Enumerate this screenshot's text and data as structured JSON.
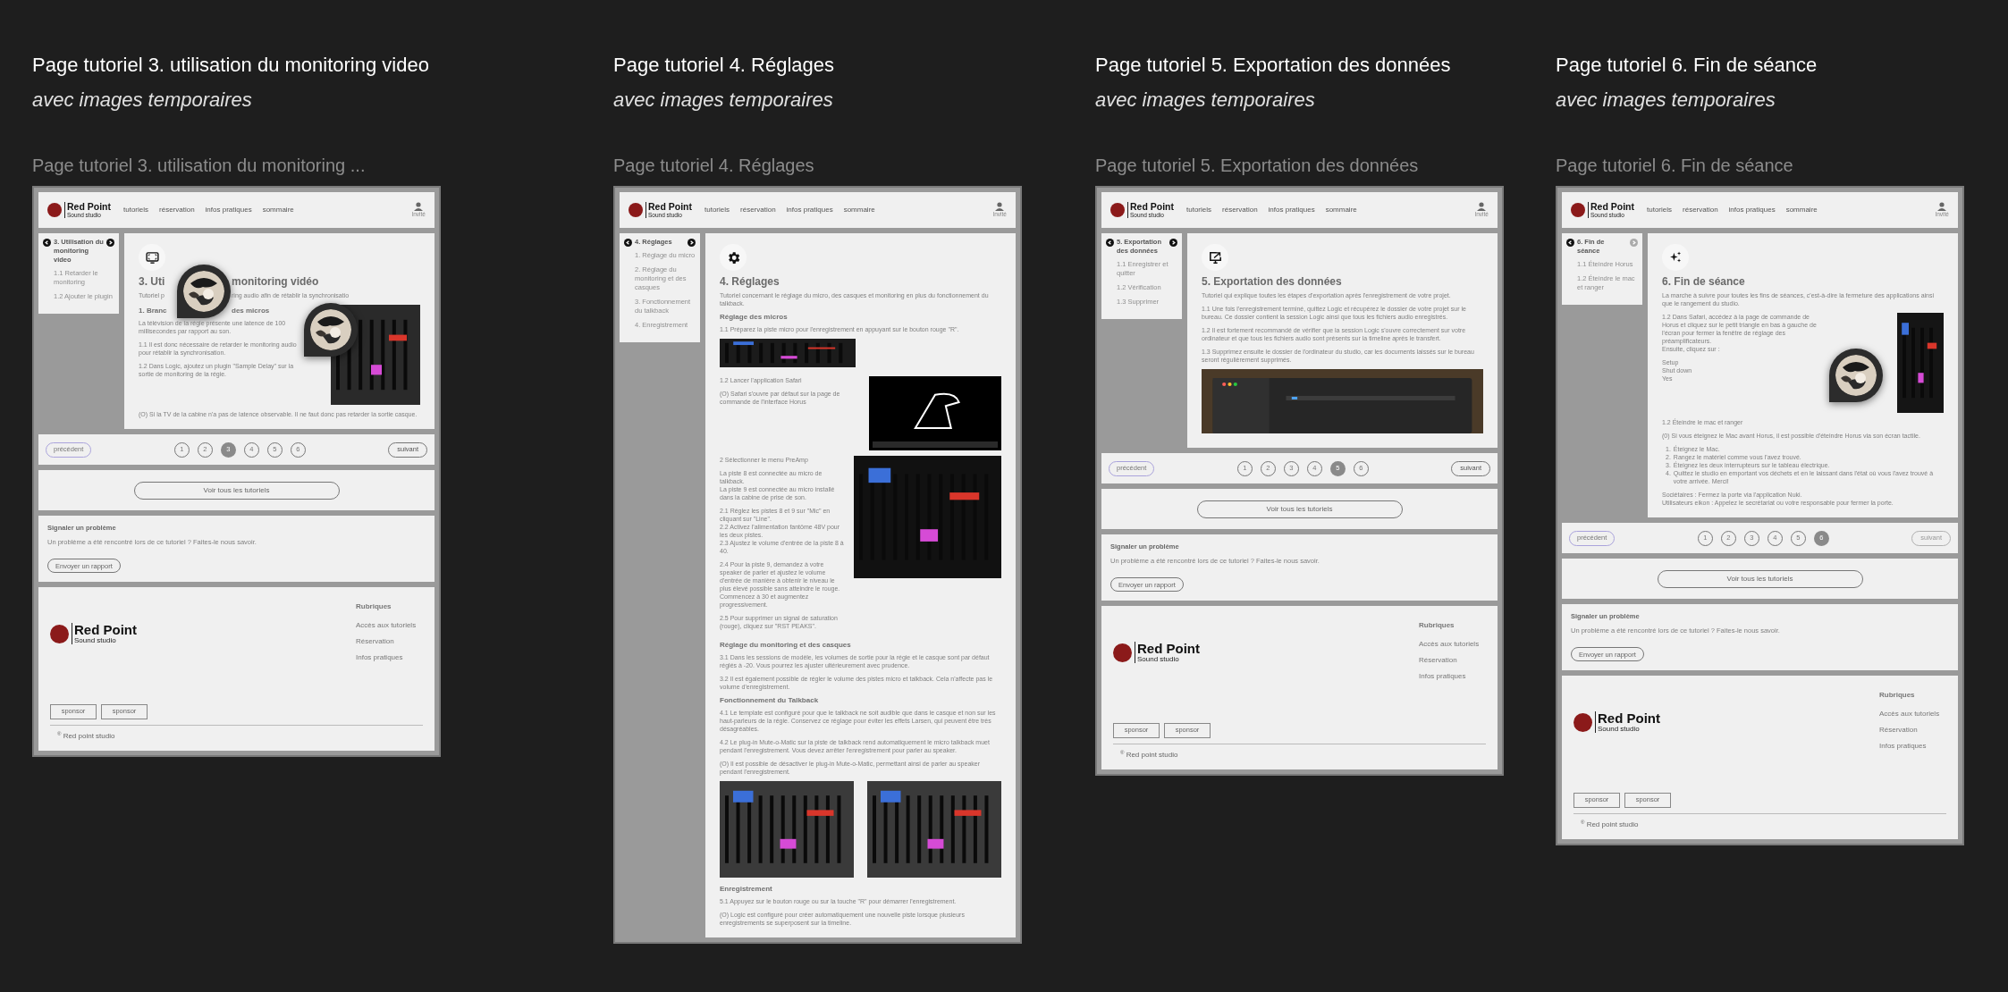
{
  "sections": [
    {
      "heading": "Page tutoriel 3. utilisation du monitoring video",
      "subheading": "avec images temporaires",
      "frame_label": "Page tutoriel 3. utilisation du monitoring ...",
      "frame": {
        "nav": {
          "brand": "Red Point",
          "brand_sub": "Sound studio",
          "links": [
            "tutoriels",
            "réservation",
            "infos pratiques",
            "sommaire"
          ],
          "user": "Invité"
        },
        "sidebar": {
          "title": "3. Utilisation du monitoring video",
          "prev_disabled": false,
          "next_disabled": false,
          "items": [
            "1.1 Retarder le monitoring",
            "1.2 Ajouter le plugin"
          ]
        },
        "article": {
          "blocks": [
            {
              "kind": "title",
              "parts": [
                "3. Uti",
                "monitoring vidéo"
              ],
              "comment_pin": true
            },
            {
              "kind": "lead",
              "parts": [
                "Tutoriel p",
                "ring audio afin de rétablir la synchronisatio"
              ]
            },
            {
              "kind": "split",
              "left": [
                {
                  "kind": "heading",
                  "parts": [
                    "1. Branc",
                    "des micros"
                  ]
                },
                {
                  "kind": "para",
                  "text": "La télévision de la régie présente une latence de 100 millisecondes par rapport au son."
                },
                {
                  "kind": "para",
                  "text": "1.1 Il est donc nécessaire de retarder le monitoring audio pour rétablir la synchronisation."
                },
                {
                  "kind": "para",
                  "text": "1.2 Dans Logic, ajoutez un plugin \"Sample Delay\" sur la sortie de monitoring de la régie."
                }
              ],
              "image": {
                "kind": "picture",
                "comment_pin": true
              }
            },
            {
              "kind": "para",
              "text": "(O) Si la TV de la cabine n'a pas de latence observable. Il ne faut donc pas retarder la sortie casque."
            }
          ]
        },
        "pager": {
          "prev": "précédent",
          "next": "suivant",
          "next_disabled": false,
          "pages": [
            {
              "label": "1",
              "selected": false
            },
            {
              "label": "2",
              "selected": false
            },
            {
              "label": "3",
              "selected": true
            },
            {
              "label": "4",
              "selected": false
            },
            {
              "label": "5",
              "selected": false
            },
            {
              "label": "6",
              "selected": false
            }
          ]
        },
        "all_button": "Voir tous les tutoriels",
        "report": {
          "title": "Signaler un problème",
          "text": "Un problème a été rencontré lors de ce tutoriel ? Faites-le nous savoir.",
          "button": "Envoyer un rapport"
        },
        "footer": {
          "brand": "Red Point",
          "brand_sub": "Sound studio",
          "heading": "Rubriques",
          "links": [
            "Accès aux tutoriels",
            "Réservation",
            "Infos pratiques"
          ],
          "sponsors": [
            "sponsor",
            "sponsor"
          ],
          "copyright": "$^{®}$ Red point studio"
        }
      }
    },
    {
      "heading": "Page tutoriel 4. Réglages",
      "subheading": "avec images temporaires",
      "frame_label": "Page tutoriel 4. Réglages",
      "frame": {
        "nav": {
          "brand": "Red Point",
          "brand_sub": "Sound studio",
          "links": [
            "tutoriels",
            "réservation",
            "infos pratiques",
            "sommaire"
          ],
          "user": "Invité"
        },
        "sidebar": {
          "title": "4. Réglages",
          "prev_disabled": false,
          "next_disabled": false,
          "items": [
            "1. Réglage du micro",
            "2. Réglage du monitoring et des casques",
            "3. Fonctionnement du talkback",
            "4. Enregistrement"
          ]
        },
        "article": {
          "blocks": [
            {
              "kind": "title",
              "text": "4. Réglages"
            },
            {
              "kind": "lead",
              "text": "Tutoriel concernant le réglage du micro, des casques et monitoring en plus du fonctionnement du talkback."
            },
            {
              "kind": "heading",
              "text": "Réglage des micros"
            },
            {
              "kind": "para",
              "text": "1.1 Préparez la piste micro pour l'enregistrement en appuyant sur le bouton rouge \"R\"."
            },
            {
              "image": {
                "kind": "picture"
              }
            },
            {
              "kind": "split",
              "left": [
                {
                  "kind": "para",
                  "text": "1.2 Lancer l'application Safari"
                },
                {
                  "kind": "para",
                  "text": "(O) Safari s'ouvre par défaut sur la page de commande de l'interface Horus"
                }
              ],
              "image": {
                "kind": "picture"
              }
            },
            {
              "kind": "split",
              "left": [
                {
                  "kind": "para",
                  "text": "2 Sélectionner le menu PreAmp"
                },
                {
                  "kind": "para",
                  "text": "La piste 8 est connectée au micro de talkback.\nLa piste 9 est connectée au micro installé dans la cabine de prise de son."
                },
                {
                  "kind": "para",
                  "text": "2.1 Réglez les pistes 8 et 9 sur \"Mic\" en cliquant sur \"Line\".\n2.2  Activez l'alimentation fantôme 48V pour les deux pistes.\n2.3 Ajustez le volume d'entrée de la piste 8 à 40."
                },
                {
                  "kind": "para",
                  "text": "2.4 Pour la piste 9, demandez à votre speaker de parler et ajustez le volume d'entrée de manière à obtenir le niveau le plus élevé possible sans atteindre le rouge. Commencez à 30 et augmentez progressivement."
                },
                {
                  "kind": "para",
                  "text": "2.5 Pour supprimer un signal de saturation (rouge), cliquez sur \"RST PEAKS\"."
                }
              ],
              "image": {
                "kind": "picture"
              }
            },
            {
              "kind": "heading",
              "text": "Réglage du monitoring et des casques"
            },
            {
              "kind": "para",
              "text": "3.1 Dans les sessions de modèle, les volumes de sortie pour la régie et le casque sont par défaut réglés à -20. Vous pourrez les ajuster ultérieurement avec prudence."
            },
            {
              "kind": "para",
              "text": "3.2 Il est également possible de régler le volume des pistes micro et talkback. Cela n'affecte pas le volume d'enregistrement."
            },
            {
              "kind": "heading",
              "text": "Fonctionnement du Talkback"
            },
            {
              "kind": "para",
              "text": "4.1 Le template est configuré pour que le talkback ne soit audible que dans le casque et non sur les haut-parleurs de la régie. Conservez ce réglage pour éviter les effets Larsen, qui peuvent être très désagréables."
            },
            {
              "kind": "para",
              "text": "4.2 Le plug-in Mute-o-Matic sur la piste de talkback rend automatiquement le micro talkback muet pendant l'enregistrement. Vous devez arrêter l'enregistrement pour parler au speaker."
            },
            {
              "kind": "para",
              "text": "(O) Il est possible de désactiver le plug-in Mute-o-Matic, permettant ainsi de parler au speaker pendant l'enregistrement."
            },
            {
              "kind": "pair",
              "images": [
                {
                  "kind": "picture"
                },
                {
                  "kind": "picture"
                }
              ]
            },
            {
              "kind": "heading",
              "text": "Enregistrement"
            },
            {
              "kind": "para",
              "text": "5.1 Appuyez sur le bouton rouge ou sur la touche \"R\" pour démarrer l'enregistrement."
            },
            {
              "kind": "para",
              "text": "(O) Logic est configuré pour créer automatiquement une nouvelle piste lorsque plusieurs enregistrements se superposent sur la timeline."
            }
          ]
        }
      }
    },
    {
      "heading": "Page tutoriel 5. Exportation des données",
      "subheading": "avec images temporaires",
      "frame_label": "Page tutoriel 5. Exportation des données",
      "frame": {
        "nav": {
          "brand": "Red Point",
          "brand_sub": "Sound studio",
          "links": [
            "tutoriels",
            "réservation",
            "infos pratiques",
            "sommaire"
          ],
          "user": "Invité"
        },
        "sidebar": {
          "title": "5. Exportation des données",
          "prev_disabled": false,
          "next_disabled": false,
          "items": [
            "1.1 Enregistrer et quitter",
            "1.2 Vérification",
            "1.3 Supprimer"
          ]
        },
        "article": {
          "blocks": [
            {
              "kind": "title",
              "text": "5. Exportation des données"
            },
            {
              "kind": "lead",
              "text": "Tutoriel qui explique toutes les étapes d'exportation après l'enregistrement de votre projet."
            },
            {
              "kind": "para",
              "text": "1.1 Une fois l'enregistrement terminé, quittez Logic et récupérez le dossier de votre projet sur le bureau. Ce dossier contient la session Logic ainsi que tous les fichiers audio enregistrés."
            },
            {
              "kind": "para",
              "text": "1.2 Il est fortement recommandé de vérifier que la session Logic s'ouvre correctement sur votre ordinateur et que tous les fichiers audio sont présents sur la timeline après le transfert."
            },
            {
              "kind": "para",
              "text": "1.3 Supprimez ensuite le dossier de l'ordinateur du studio, car les documents laissés sur le bureau seront régulièrement supprimés."
            },
            {
              "image": {
                "kind": "picture"
              }
            }
          ]
        },
        "pager": {
          "prev": "précédent",
          "next": "suivant",
          "next_disabled": false,
          "pages": [
            {
              "label": "1",
              "selected": false
            },
            {
              "label": "2",
              "selected": false
            },
            {
              "label": "3",
              "selected": false
            },
            {
              "label": "4",
              "selected": false
            },
            {
              "label": "5",
              "selected": true
            },
            {
              "label": "6",
              "selected": false
            }
          ]
        },
        "all_button": "Voir tous les tutoriels",
        "report": {
          "title": "Signaler un problème",
          "text": "Un problème a été rencontré lors de ce tutoriel ? Faites-le nous savoir.",
          "button": "Envoyer un rapport"
        },
        "footer": {
          "brand": "Red Point",
          "brand_sub": "Sound studio",
          "heading": "Rubriques",
          "links": [
            "Accès aux tutoriels",
            "Réservation",
            "Infos pratiques"
          ],
          "sponsors": [
            "sponsor",
            "sponsor"
          ],
          "copyright": "$^{®}$ Red point studio"
        }
      }
    },
    {
      "heading": "Page tutoriel 6. Fin de séance",
      "subheading": "avec images temporaires",
      "frame_label": "Page tutoriel 6. Fin de séance",
      "frame": {
        "nav": {
          "brand": "Red Point",
          "brand_sub": "Sound studio",
          "links": [
            "tutoriels",
            "réservation",
            "infos pratiques",
            "sommaire"
          ],
          "user": "Invité"
        },
        "sidebar": {
          "title": "6. Fin de séance",
          "prev_disabled": false,
          "next_disabled": true,
          "items": [
            "1.1 Éteindre Horus",
            "1.2 Éteindre le mac et ranger"
          ]
        },
        "article": {
          "blocks": [
            {
              "kind": "title",
              "text": "6. Fin de séance"
            },
            {
              "kind": "lead",
              "text": "La marche à suivre pour toutes les fins de séances, c'est-à-dire la fermeture des applications ainsi que le rangement du studio."
            },
            {
              "kind": "split",
              "comment_pin": true,
              "left": [
                {
                  "kind": "para",
                  "text": "1.2 Dans Safari, accédez à la page de commande de Horus et cliquez sur le petit triangle en bas à gauche de l'écran pour fermer la fenêtre de réglage des préamplificateurs.\nEnsuite, cliquez sur :"
                },
                {
                  "kind": "para",
                  "text": "Setup\nShut down\nYes"
                }
              ],
              "image": {
                "kind": "picture"
              }
            },
            {
              "kind": "para",
              "text": "1.2 Éteindre le mac et ranger"
            },
            {
              "kind": "para",
              "text": "(0) Si vous éteignez le Mac avant Horus, il est possible d'éteindre Horus via son écran tactile."
            },
            {
              "kind": "list",
              "items": [
                {
                  "number": "1.",
                  "text": "Éteignez le Mac."
                },
                {
                  "number": "2.",
                  "text": "Rangez le matériel comme vous l'avez trouvé."
                },
                {
                  "number": "3.",
                  "text": "Éteignez les deux interrupteurs sur le tableau électrique."
                },
                {
                  "number": "4.",
                  "text": "Quittez le studio en emportant vos déchets et en le laissant dans l'état où vous l'avez trouvé à votre arrivée. Merci!"
                }
              ]
            },
            {
              "kind": "para",
              "text": "Sociétaires : Fermez la porte via l'application Nuki.\nUtilisateurs eikon : Appelez le secrétariat ou votre responsable pour fermer la porte."
            }
          ]
        },
        "pager": {
          "prev": "précédent",
          "next": "suivant",
          "next_disabled": true,
          "pages": [
            {
              "label": "1",
              "selected": false
            },
            {
              "label": "2",
              "selected": false
            },
            {
              "label": "3",
              "selected": false
            },
            {
              "label": "4",
              "selected": false
            },
            {
              "label": "5",
              "selected": false
            },
            {
              "label": "6",
              "selected": true
            }
          ]
        },
        "all_button": "Voir tous les tutoriels",
        "report": {
          "title": "Signaler un problème",
          "text": "Un problème a été rencontré lors de ce tutoriel ? Faites-le nous savoir.",
          "button": "Envoyer un rapport"
        },
        "footer": {
          "brand": "Red Point",
          "brand_sub": "Sound studio",
          "heading": "Rubriques",
          "links": [
            "Accès aux tutoriels",
            "Réservation",
            "Infos pratiques"
          ],
          "sponsors": [
            "sponsor",
            "sponsor"
          ],
          "copyright": "$^{®}$ Red point studio"
        }
      }
    }
  ]
}
